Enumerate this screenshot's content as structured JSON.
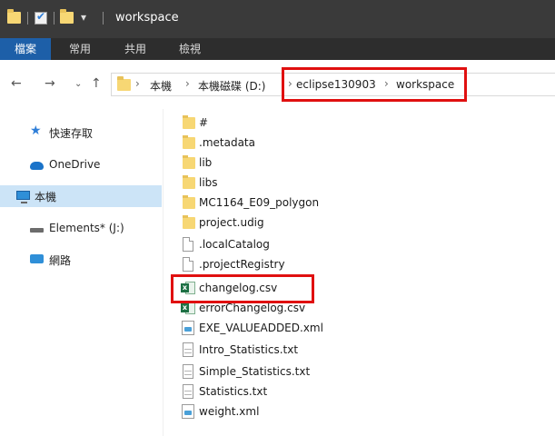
{
  "window": {
    "title": "workspace"
  },
  "menu": {
    "items": [
      {
        "label": "檔案",
        "active": true
      },
      {
        "label": "常用"
      },
      {
        "label": "共用"
      },
      {
        "label": "檢視"
      }
    ]
  },
  "address": {
    "crumbs": [
      "本機",
      "本機磁碟 (D:)",
      "eclipse130903",
      "workspace"
    ]
  },
  "sidebar": {
    "items": [
      {
        "label": "快速存取",
        "icon": "star-icon"
      },
      {
        "label": "OneDrive",
        "icon": "cloud-icon"
      },
      {
        "label": "本機",
        "icon": "computer-icon",
        "selected": true
      },
      {
        "label": "Elements* (J:)",
        "icon": "drive-icon"
      },
      {
        "label": "網路",
        "icon": "network-icon"
      }
    ]
  },
  "files": [
    {
      "name": "#",
      "type": "folder"
    },
    {
      "name": ".metadata",
      "type": "folder"
    },
    {
      "name": "lib",
      "type": "folder"
    },
    {
      "name": "libs",
      "type": "folder"
    },
    {
      "name": "MC1164_E09_polygon",
      "type": "folder"
    },
    {
      "name": "project.udig",
      "type": "folder"
    },
    {
      "name": ".localCatalog",
      "type": "file"
    },
    {
      "name": ".projectRegistry",
      "type": "file"
    },
    {
      "name": "changelog.csv",
      "type": "csv"
    },
    {
      "name": "errorChangelog.csv",
      "type": "csv"
    },
    {
      "name": "EXE_VALUEADDED.xml",
      "type": "xml"
    },
    {
      "name": "Intro_Statistics.txt",
      "type": "txt"
    },
    {
      "name": "Simple_Statistics.txt",
      "type": "txt"
    },
    {
      "name": "Statistics.txt",
      "type": "txt"
    },
    {
      "name": "weight.xml",
      "type": "xml"
    }
  ],
  "colors": {
    "highlight_box": "#e01010",
    "menu_active": "#1d5fa8",
    "selected_row": "#cce4f7"
  }
}
